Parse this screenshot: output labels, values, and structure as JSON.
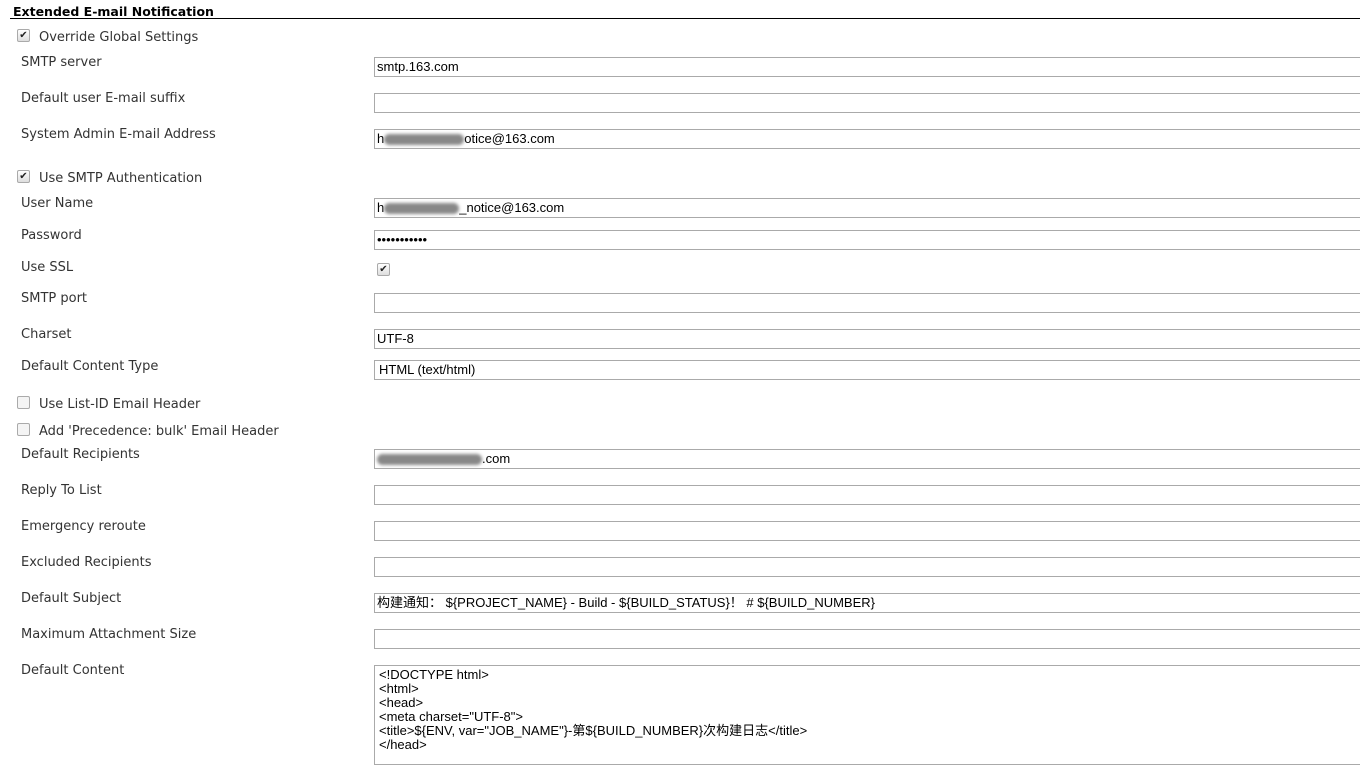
{
  "section_title": "Extended E-mail Notification",
  "override": {
    "label": "Override Global Settings",
    "checked": true
  },
  "smtp_server": {
    "label": "SMTP server",
    "value": "smtp.163.com"
  },
  "email_suffix": {
    "label": "Default user E-mail suffix",
    "value": ""
  },
  "admin_email": {
    "label": "System Admin E-mail Address",
    "value_prefix": "h",
    "value_suffix": "otice@163.com"
  },
  "smtp_auth": {
    "label": "Use SMTP Authentication",
    "checked": true
  },
  "user_name": {
    "label": "User Name",
    "value_prefix": "h",
    "value_suffix": "_notice@163.com"
  },
  "password": {
    "label": "Password",
    "value": "•••••••••••"
  },
  "use_ssl": {
    "label": "Use SSL",
    "checked": true
  },
  "smtp_port": {
    "label": "SMTP port",
    "value": ""
  },
  "charset": {
    "label": "Charset",
    "value": "UTF-8"
  },
  "content_type": {
    "label": "Default Content Type",
    "value": "HTML (text/html)"
  },
  "list_id": {
    "label": "Use List-ID Email Header",
    "checked": false
  },
  "precedence": {
    "label": "Add 'Precedence: bulk' Email Header",
    "checked": false
  },
  "recipients": {
    "label": "Default Recipients",
    "value_prefix": "",
    "value_suffix": ".com"
  },
  "reply_to": {
    "label": "Reply To List",
    "value": ""
  },
  "reroute": {
    "label": "Emergency reroute",
    "value": ""
  },
  "excluded": {
    "label": "Excluded Recipients",
    "value": ""
  },
  "subject": {
    "label": "Default Subject",
    "value": "构建通知： ${PROJECT_NAME} - Build - ${BUILD_STATUS}！ # ${BUILD_NUMBER}"
  },
  "max_attach": {
    "label": "Maximum Attachment Size",
    "value": ""
  },
  "content": {
    "label": "Default Content",
    "value": "<!DOCTYPE html>\n<html>\n<head>\n<meta charset=\"UTF-8\">\n<title>${ENV, var=\"JOB_NAME\"}-第${BUILD_NUMBER}次构建日志</title>\n</head>"
  }
}
